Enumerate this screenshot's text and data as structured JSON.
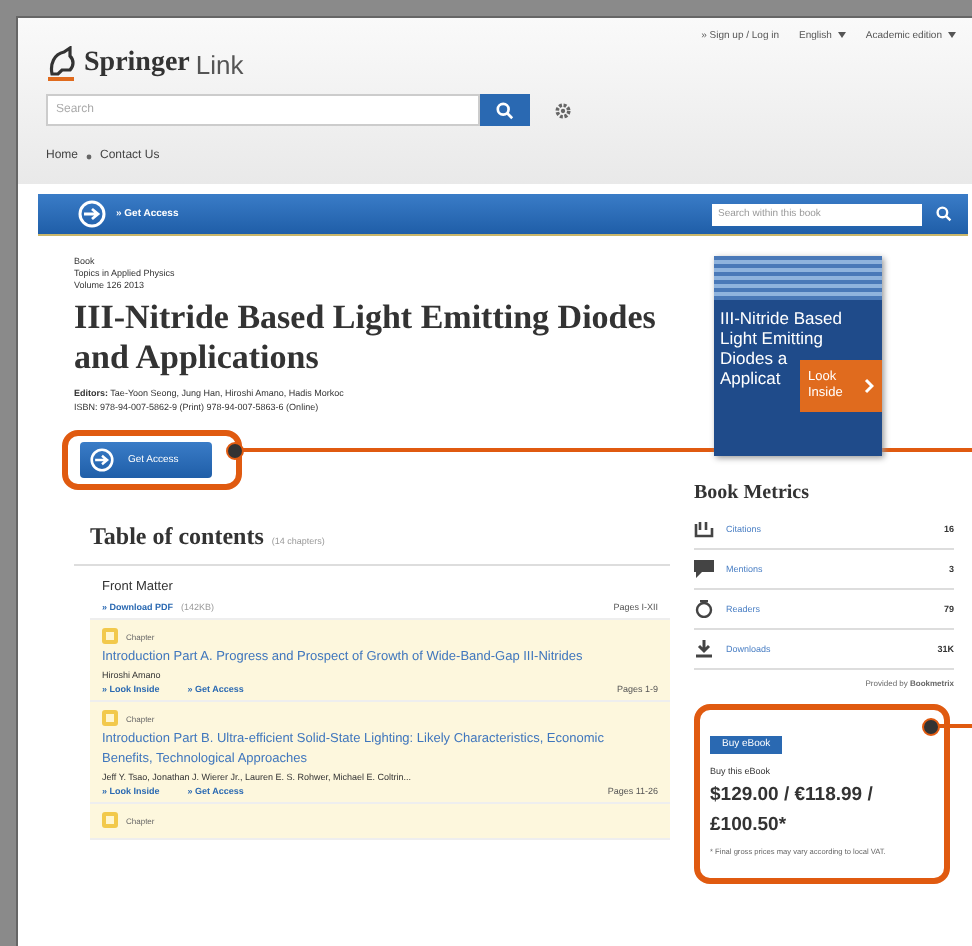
{
  "header": {
    "logo_bold": "Springer",
    "logo_light": "Link",
    "top_links": [
      {
        "label": "» Sign up / Log in",
        "dropdown": false
      },
      {
        "label": "English",
        "dropdown": true
      },
      {
        "label": "Academic edition",
        "dropdown": true
      }
    ],
    "search": {
      "placeholder": "Search"
    },
    "breadcrumb": [
      "Home",
      "Contact Us"
    ]
  },
  "access_bar": {
    "link": "» Get Access",
    "search": {
      "placeholder": "Search within this book"
    }
  },
  "book": {
    "type": "Book",
    "series": "Topics in Applied Physics",
    "volume": "Volume 126 2013",
    "title": "III-Nitride Based Light Emitting Diodes and Applications",
    "editors": "**Editors:** Tae-Yoon Seong, Jung Han, Hiroshi Amano, Hadis Morkoc",
    "isbn": "ISBN: 978-94-007-5862-9 (Print) 978-94-007-5863-6 (Online)",
    "button": "Get Access"
  },
  "cover": {
    "lines": [
      "III-Nitride Based",
      "Light Emitting",
      "Diodes a",
      "Applicat"
    ],
    "look_inside": "Look Inside"
  },
  "toc": {
    "heading": "Table of contents",
    "count": "(14 chapters)",
    "items": [
      {
        "kind": "front",
        "title": "Front Matter",
        "links": [
          "» Download PDF"
        ],
        "size": "(142KB)",
        "pages": "Pages I-XII"
      },
      {
        "kind": "chapter",
        "label": "Chapter",
        "title": "Introduction Part A. Progress and Prospect of Growth of Wide-Band-Gap III-Nitrides",
        "authors": "Hiroshi Amano",
        "links": [
          "» Look Inside",
          "» Get Access"
        ],
        "pages": "Pages 1-9"
      },
      {
        "kind": "chapter",
        "label": "Chapter",
        "title": "Introduction Part B. Ultra-efficient Solid-State Lighting: Likely Characteristics, Economic Benefits, Technological Approaches",
        "authors": "Jeff Y. Tsao, Jonathan J. Wierer Jr., Lauren E. S. Rohwer, Michael E. Coltrin...",
        "links": [
          "» Look Inside",
          "» Get Access"
        ],
        "pages": "Pages 11-26"
      },
      {
        "kind": "partial",
        "label": "Chapter"
      }
    ]
  },
  "metrics": {
    "heading": "Book Metrics",
    "rows": [
      {
        "kind": "citations",
        "label": "Citations",
        "value": "16"
      },
      {
        "kind": "mentions",
        "label": "Mentions",
        "value": "3"
      },
      {
        "kind": "readers",
        "label": "Readers",
        "value": "79"
      },
      {
        "kind": "downloads",
        "label": "Downloads",
        "value": "31K"
      }
    ],
    "provided": "Provided by **Bookmetrix**"
  },
  "buy": {
    "button": "Buy eBook",
    "label": "Buy this eBook",
    "price": "$129.00 / €118.99 / £100.50*",
    "note": "* Final gross prices may vary according to local VAT."
  }
}
